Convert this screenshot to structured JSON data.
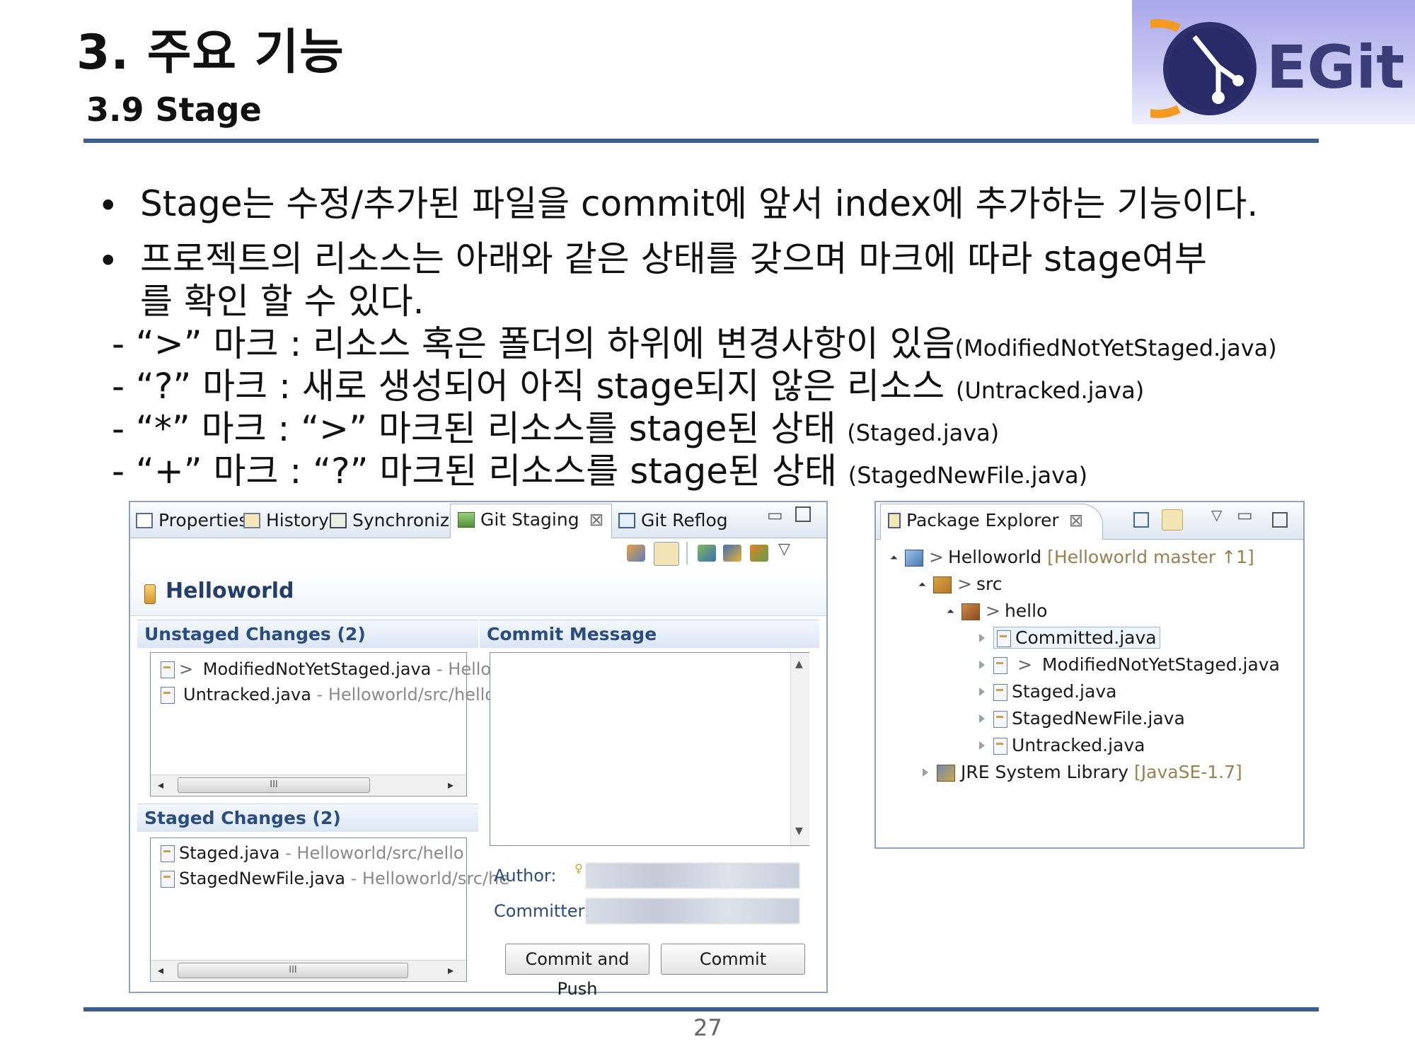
{
  "header": {
    "title": "3. 주요 기능",
    "subtitle": "3.9 Stage",
    "logo_text": "EGit"
  },
  "bullets": [
    {
      "lines": [
        "Stage는 수정/추가된 파일을 commit에 앞서 index에 추가하는 기능이다."
      ]
    },
    {
      "lines": [
        "프로젝트의 리소스는 아래와 같은 상태를 갖으며 마크에 따라 stage여부",
        "를 확인 할 수 있다."
      ]
    }
  ],
  "marks": [
    {
      "text": "- “>” 마크 : 리소스 혹은 폴더의 하위에 변경사항이 있음",
      "note": "(ModifiedNotYetStaged.java)"
    },
    {
      "text": "- “?” 마크 : 새로 생성되어 아직 stage되지 않은 리소스",
      "note": "(Untracked.java)"
    },
    {
      "text": "- “*” 마크 : “>” 마크된 리소스를 stage된 상태",
      "note": "(Staged.java)"
    },
    {
      "text": "- “+” 마크 : “?” 마크된 리소스를 stage된 상태",
      "note": "(StagedNewFile.java)"
    }
  ],
  "staging_view": {
    "tabs": [
      "Properties",
      "History",
      "Synchronize",
      "Git Staging",
      "Git Reflog"
    ],
    "repo": "Helloworld",
    "unstaged_header": "Unstaged Changes (2)",
    "unstaged": [
      {
        "prefix": "> ",
        "name": "ModifiedNotYetStaged.java",
        "path": " - Hellow"
      },
      {
        "prefix": "",
        "name": "Untracked.java",
        "path": " - Helloworld/src/hello"
      }
    ],
    "staged_header": "Staged Changes (2)",
    "staged": [
      {
        "prefix": "",
        "name": "Staged.java",
        "path": " - Helloworld/src/hello"
      },
      {
        "prefix": "",
        "name": "StagedNewFile.java",
        "path": " - Helloworld/src/he"
      }
    ],
    "commit_message_header": "Commit Message",
    "author_label": "Author:",
    "committer_label": "Committer:",
    "scroll_grip": "III",
    "commit_push_label": "Commit and Push",
    "commit_label": "Commit"
  },
  "package_explorer": {
    "tab": "Package Explorer",
    "project": "Helloworld",
    "project_decor": "[Helloworld master ↑1]",
    "src": "src",
    "pkg": "hello",
    "files": [
      {
        "prefix": "",
        "name": "Committed.java"
      },
      {
        "prefix": "> ",
        "name": "ModifiedNotYetStaged.java"
      },
      {
        "prefix": "",
        "name": "Staged.java"
      },
      {
        "prefix": "",
        "name": "StagedNewFile.java"
      },
      {
        "prefix": "",
        "name": "Untracked.java"
      }
    ],
    "jre": "JRE System Library",
    "jre_decor": "[JavaSE-1.7]"
  },
  "footer": {
    "page": "27"
  },
  "colors": {
    "rule": "#3a5f8f",
    "section_header": "#2a4d80",
    "logo_text": "#3a3c78"
  }
}
